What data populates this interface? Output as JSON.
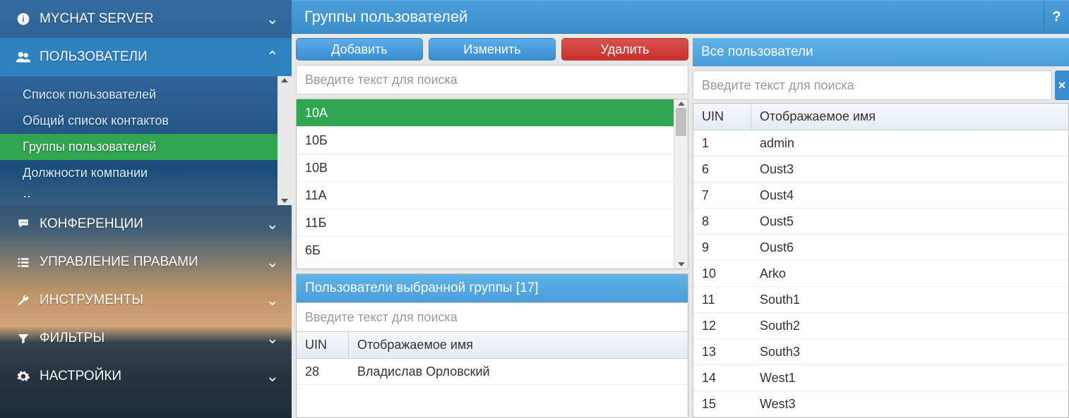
{
  "sidebar": {
    "sections": [
      {
        "id": "server",
        "label": "MYCHAT SERVER",
        "icon": "info",
        "expanded": false
      },
      {
        "id": "users",
        "label": "ПОЛЬЗОВАТЕЛИ",
        "icon": "users",
        "expanded": true
      },
      {
        "id": "conferences",
        "label": "КОНФЕРЕНЦИИ",
        "icon": "chat",
        "expanded": false
      },
      {
        "id": "rights",
        "label": "УПРАВЛЕНИЕ ПРАВАМИ",
        "icon": "list",
        "expanded": false
      },
      {
        "id": "tools",
        "label": "ИНСТРУМЕНТЫ",
        "icon": "wrench",
        "expanded": false
      },
      {
        "id": "filters",
        "label": "ФИЛЬТРЫ",
        "icon": "filter",
        "expanded": false
      },
      {
        "id": "settings",
        "label": "НАСТРОЙКИ",
        "icon": "gear",
        "expanded": false
      }
    ],
    "users_submenu": [
      {
        "label": "Список пользователей",
        "active": false
      },
      {
        "label": "Общий список контактов",
        "active": false
      },
      {
        "label": "Группы пользователей",
        "active": true
      },
      {
        "label": "Должности компании",
        "active": false
      }
    ]
  },
  "page": {
    "title": "Группы пользователей",
    "help": "?"
  },
  "toolbar": {
    "add": "Добавить",
    "edit": "Изменить",
    "del": "Удалить"
  },
  "search": {
    "placeholder": "Введите текст для поиска"
  },
  "groups": {
    "items": [
      "10А",
      "10Б",
      "10В",
      "11А",
      "11Б",
      "6Б"
    ],
    "selected_index": 0
  },
  "members": {
    "title": "Пользователи выбранной группы [17]",
    "columns": {
      "uin": "UIN",
      "name": "Отображаемое имя"
    },
    "rows": [
      {
        "uin": "28",
        "name": "Владислав Орловский"
      }
    ]
  },
  "all_users": {
    "title": "Все пользователи",
    "columns": {
      "uin": "UIN",
      "name": "Отображаемое имя"
    },
    "rows": [
      {
        "uin": "1",
        "name": "admin"
      },
      {
        "uin": "6",
        "name": "Oust3"
      },
      {
        "uin": "7",
        "name": "Oust4"
      },
      {
        "uin": "8",
        "name": "Oust5"
      },
      {
        "uin": "9",
        "name": "Oust6"
      },
      {
        "uin": "10",
        "name": "Arko"
      },
      {
        "uin": "11",
        "name": "South1"
      },
      {
        "uin": "12",
        "name": "South2"
      },
      {
        "uin": "13",
        "name": "South3"
      },
      {
        "uin": "14",
        "name": "West1"
      },
      {
        "uin": "15",
        "name": "West3"
      }
    ]
  }
}
